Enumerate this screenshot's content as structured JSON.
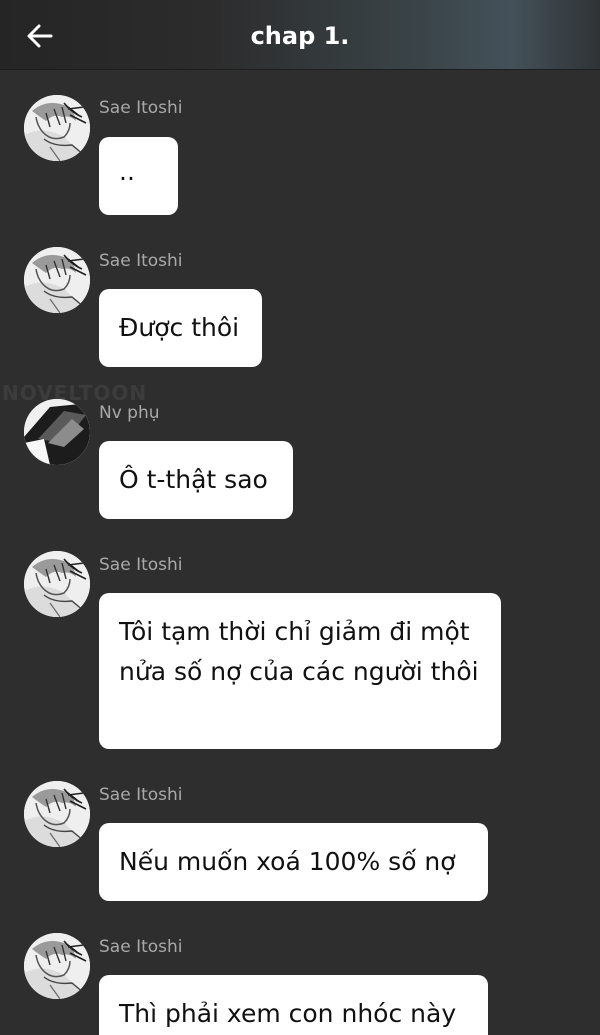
{
  "header": {
    "title": "chap 1.",
    "back_icon": "arrow-left-icon"
  },
  "watermark": "NOVELTOON",
  "messages": [
    {
      "sender": "Sae Itoshi",
      "text": "..",
      "avatar": "sae-avatar"
    },
    {
      "sender": "Sae Itoshi",
      "text": "Được thôi",
      "avatar": "sae-avatar"
    },
    {
      "sender": "Nv phụ",
      "text": "Ô t-thật sao",
      "avatar": "nv-avatar"
    },
    {
      "sender": "Sae Itoshi",
      "text": "Tôi tạm thời chỉ giảm đi một nửa số nợ của các người thôi",
      "avatar": "sae-avatar"
    },
    {
      "sender": "Sae Itoshi",
      "text": "Nếu muốn xoá 100% số nợ",
      "avatar": "sae-avatar"
    },
    {
      "sender": "Sae Itoshi",
      "text": "Thì phải xem con nhóc này",
      "avatar": "sae-avatar"
    }
  ]
}
